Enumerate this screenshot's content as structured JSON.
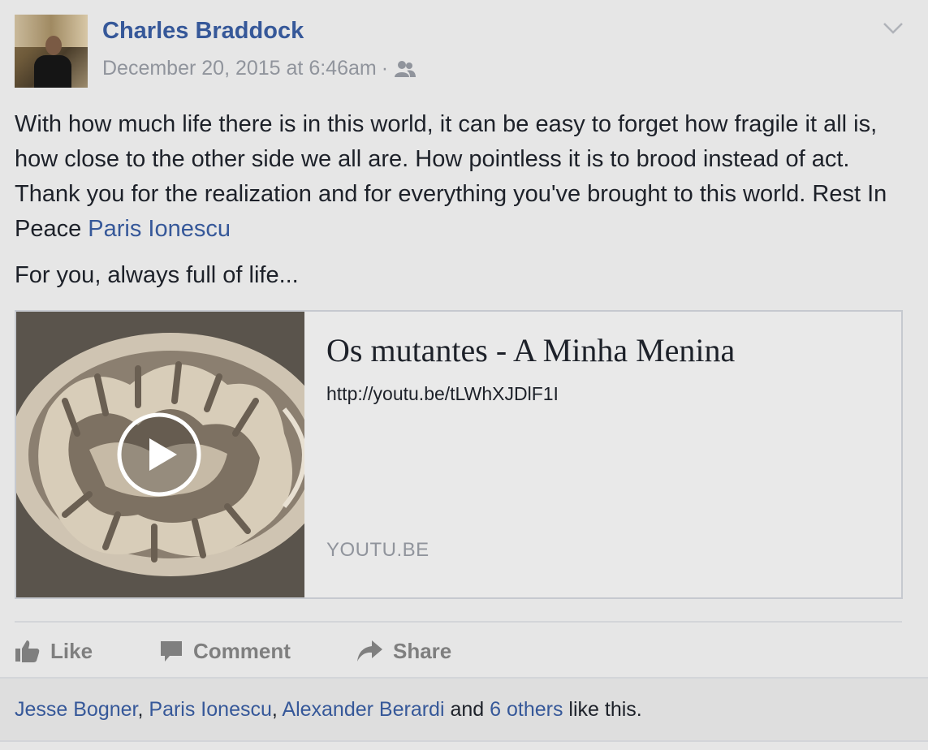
{
  "post": {
    "author": "Charles Braddock",
    "timestamp": "December 20, 2015 at 6:46am",
    "separator": "·",
    "audience_icon": "friends-icon",
    "menu_icon": "chevron-down-icon",
    "text": {
      "p1_before": "With how much life there is in this world, it can be easy to forget how fragile it all is, how close to the other side we all are. How pointless it is to brood instead of act. Thank you for the realization and for everything you've brought to this world. Rest In Peace ",
      "p1_mention": "Paris Ionescu",
      "p2": "For you, always full of life..."
    },
    "link_card": {
      "title": "Os mutantes - A Minha Menina",
      "url": "http://youtu.be/tLWhXJDlF1I",
      "domain": "YOUTU.BE",
      "thumbnail_icon": "play-icon"
    }
  },
  "actions": {
    "like": "Like",
    "comment": "Comment",
    "share": "Share"
  },
  "likes": {
    "names": [
      "Jesse Bogner",
      "Paris Ionescu",
      "Alexander Berardi"
    ],
    "comma": ", ",
    "and_text": " and ",
    "others": "6 others",
    "suffix": " like this."
  },
  "colors": {
    "link": "#365899",
    "text": "#1d2129",
    "meta": "#90949c",
    "action": "#7f7f7f",
    "background": "#e6e6e6"
  }
}
